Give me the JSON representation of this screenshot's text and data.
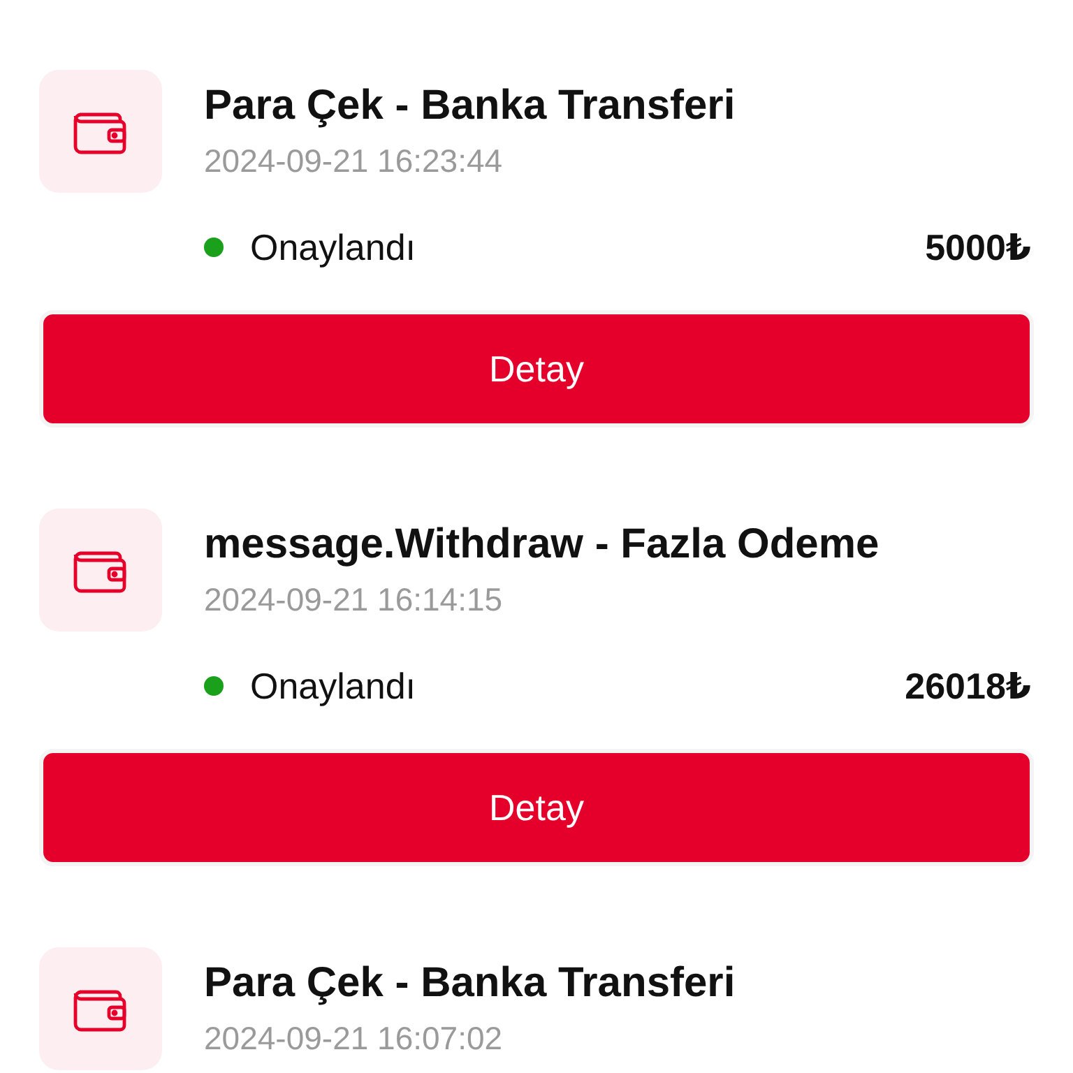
{
  "transactions": [
    {
      "title": "Para Çek - Banka Transferi",
      "date": "2024-09-21 16:23:44",
      "status": {
        "label": "Onaylandı",
        "color": "#1aa01a"
      },
      "amount": "5000₺",
      "button": "Detay"
    },
    {
      "title": "message.Withdraw - Fazla Odeme",
      "date": "2024-09-21 16:14:15",
      "status": {
        "label": "Onaylandı",
        "color": "#1aa01a"
      },
      "amount": "26018₺",
      "button": "Detay"
    },
    {
      "title": "Para Çek - Banka Transferi",
      "date": "2024-09-21 16:07:02"
    }
  ]
}
